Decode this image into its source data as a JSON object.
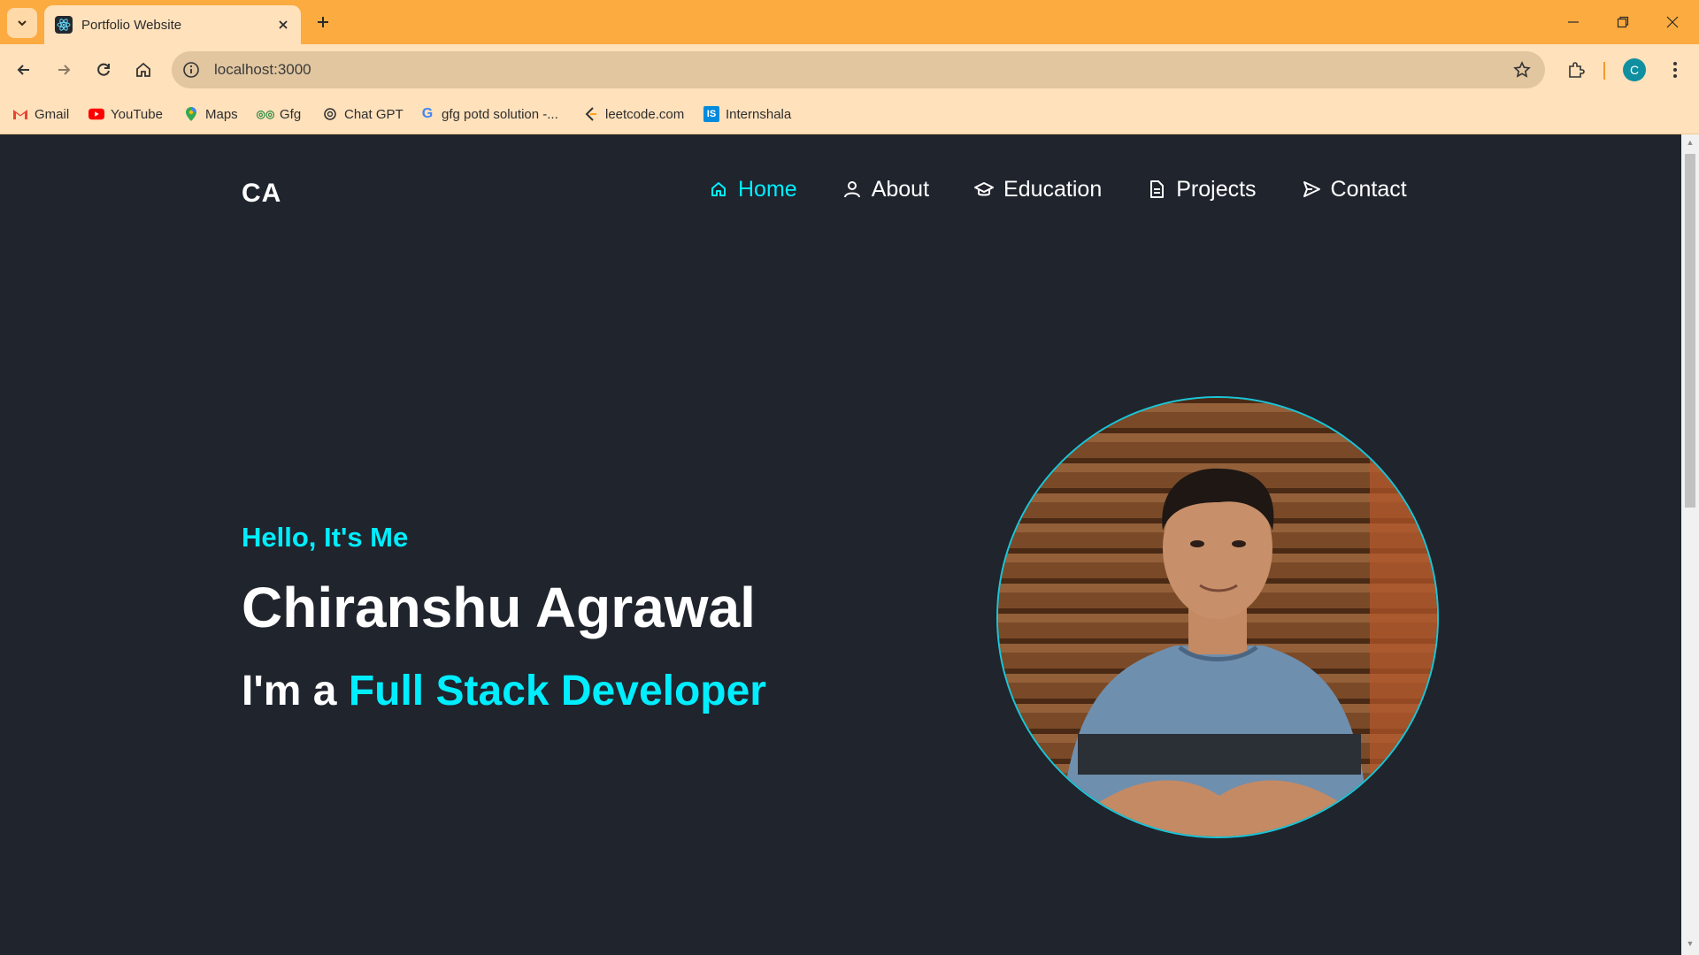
{
  "browser": {
    "tab_title": "Portfolio Website",
    "url": "localhost:3000",
    "profile_initial": "C",
    "accent_color": "#fbab40",
    "bookmarks": [
      {
        "label": "Gmail",
        "icon": "gmail-icon"
      },
      {
        "label": "YouTube",
        "icon": "youtube-icon"
      },
      {
        "label": "Maps",
        "icon": "maps-icon"
      },
      {
        "label": "Gfg",
        "icon": "gfg-icon"
      },
      {
        "label": "Chat GPT",
        "icon": "chatgpt-icon"
      },
      {
        "label": "gfg potd solution -...",
        "icon": "google-icon"
      },
      {
        "label": "leetcode.com",
        "icon": "leetcode-icon"
      },
      {
        "label": "Internshala",
        "icon": "internshala-icon"
      }
    ]
  },
  "site": {
    "logo": "CA",
    "nav": [
      {
        "label": "Home",
        "icon": "home-icon",
        "active": true
      },
      {
        "label": "About",
        "icon": "user-icon",
        "active": false
      },
      {
        "label": "Education",
        "icon": "graduation-cap-icon",
        "active": false
      },
      {
        "label": "Projects",
        "icon": "document-icon",
        "active": false
      },
      {
        "label": "Contact",
        "icon": "send-icon",
        "active": false
      }
    ],
    "hero": {
      "greeting": "Hello, It's Me",
      "name": "Chiranshu Agrawal",
      "role_prefix": "I'm a",
      "role_highlight": "Full Stack Developer"
    },
    "colors": {
      "background": "#1f242d",
      "accent": "#00eeff",
      "text": "#ffffff"
    }
  }
}
